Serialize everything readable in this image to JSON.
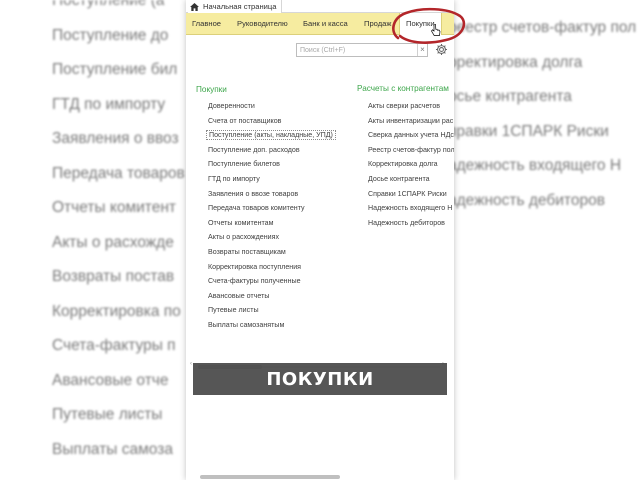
{
  "background": {
    "left_items": [
      "Поступление (а",
      "Поступление до",
      "Поступление бил",
      "ГТД по импорту",
      "Заявления о ввоз",
      "Передача товаров",
      "Отчеты комитент",
      "Акты о расхожде",
      "Возвраты постав",
      "Корректировка по",
      "Счета-фактуры п",
      "Авансовые отче",
      "Путевые листы",
      "Выплаты самоза"
    ],
    "right_items": [
      "",
      "реестр счетов-фактур пол",
      "рректировка долга",
      "осье контрагента",
      "правки 1СПАРК Риски",
      "адежность входящего Н",
      "адежность дебиторов"
    ]
  },
  "tabbar": {
    "home_tab_label": "Начальная страница"
  },
  "menu": {
    "items": [
      "Главное",
      "Руководителю",
      "Банк и касса",
      "Продаж",
      "Покупки"
    ],
    "active_index": 4
  },
  "search": {
    "placeholder": "Поиск (Ctrl+F)",
    "clear_symbol": "×"
  },
  "purchases": {
    "title": "Покупки",
    "links": [
      "Доверенности",
      "Счета от поставщиков",
      "Поступление (акты, накладные, УПД)",
      "Поступление доп. расходов",
      "Поступление билетов",
      "ГТД по импорту",
      "Заявления о ввозе товаров",
      "Передача товаров комитенту",
      "Отчеты комитентам",
      "Акты о расхождениях",
      "Возвраты поставщикам",
      "Корректировка поступления",
      "Счета-фактуры полученные",
      "Авансовые отчеты",
      "Путевые листы",
      "Выплаты самозанятым"
    ],
    "focused_index": 2
  },
  "settlements": {
    "title": "Расчеты с контрагентам",
    "links": [
      "Акты сверки расчетов",
      "Акты инвентаризации рас",
      "Сверка данных учета НДс",
      "Реестр счетов-фактур пол",
      "Корректировка долга",
      "Досье контрагента",
      "Справки 1СПАРК Риски",
      "Надежность входящего Н",
      "Надежность дебиторов"
    ]
  },
  "caption": {
    "text": "ПОКУПКИ"
  },
  "colors": {
    "menu_bar": "#f6eca0",
    "section_title": "#3da64b",
    "annotation_circle": "#b3262a",
    "caption_bg": "#484848"
  },
  "icons": [
    "home-icon",
    "gear-icon",
    "close-icon",
    "cursor-icon"
  ]
}
